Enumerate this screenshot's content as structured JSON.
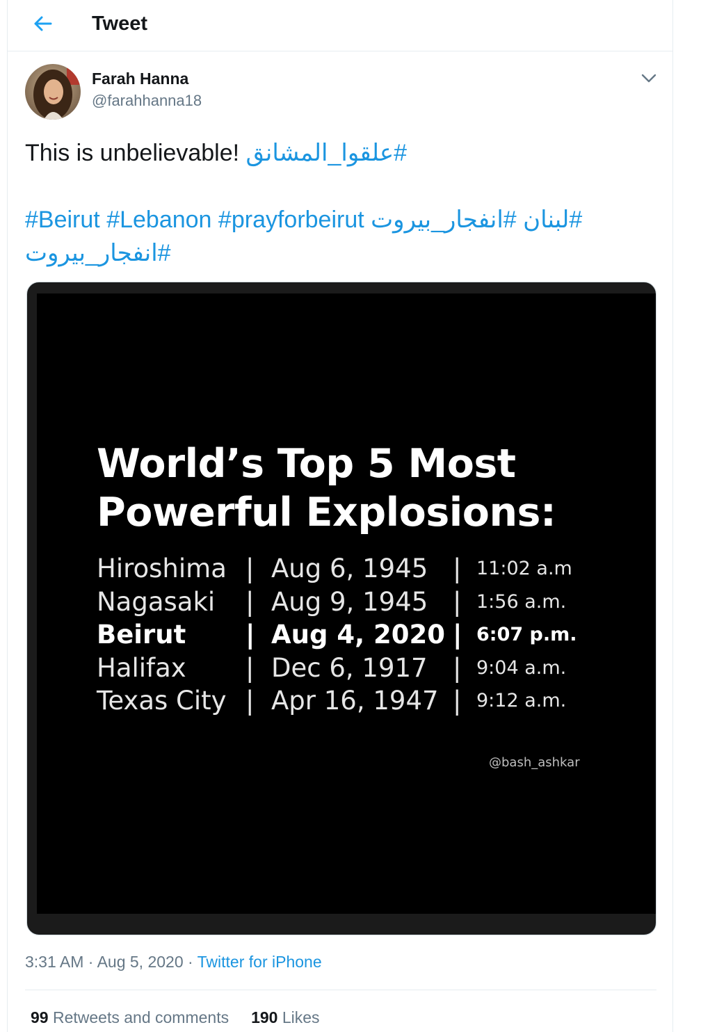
{
  "header": {
    "title": "Tweet",
    "back_icon": "arrow-left-icon",
    "accent": "#1da1f2"
  },
  "author": {
    "name": "Farah Hanna",
    "handle": "@farahhanna18"
  },
  "tweet": {
    "text_plain": "This is unbelievable! ",
    "hashtag_1": "#علقوا_المشانق",
    "line2": [
      {
        "text": "#Beirut"
      },
      {
        "text": "#Lebanon"
      },
      {
        "text": "#prayforbeirut"
      },
      {
        "text": "#انفجار_بيروت"
      },
      {
        "text": "#لبنان"
      }
    ],
    "line3_tag": "#انفجار_بيروت",
    "link_color": "#1b95e0"
  },
  "media": {
    "title_line1": "World’s Top 5 Most",
    "title_line2": "Powerful Explosions:",
    "rows": [
      {
        "city": "Hiroshima",
        "sep": "|",
        "date": "Aug 6, 1945",
        "sep2": "|",
        "time": "11:02 a.m"
      },
      {
        "city": "Nagasaki",
        "sep": "|",
        "date": "Aug 9, 1945",
        "sep2": "|",
        "time": "1:56 a.m."
      },
      {
        "city": "Beirut",
        "sep": "|",
        "date": "Aug 4, 2020",
        "sep2": "|",
        "time": "6:07 p.m."
      },
      {
        "city": "Halifax",
        "sep": "|",
        "date": "Dec 6, 1917",
        "sep2": "|",
        "time": "9:04 a.m."
      },
      {
        "city": "Texas City",
        "sep": "|",
        "date": "Apr 16, 1947",
        "sep2": "|",
        "time": "9:12 a.m."
      }
    ],
    "credit": "@bash_ashkar"
  },
  "meta": {
    "time": "3:31 AM",
    "dot": " · ",
    "date": "Aug 5, 2020",
    "dot2": " · ",
    "source": "Twitter for iPhone"
  },
  "stats": {
    "retweets_count": "99",
    "retweets_label": "Retweets and comments",
    "likes_count": "190",
    "likes_label": "Likes"
  }
}
